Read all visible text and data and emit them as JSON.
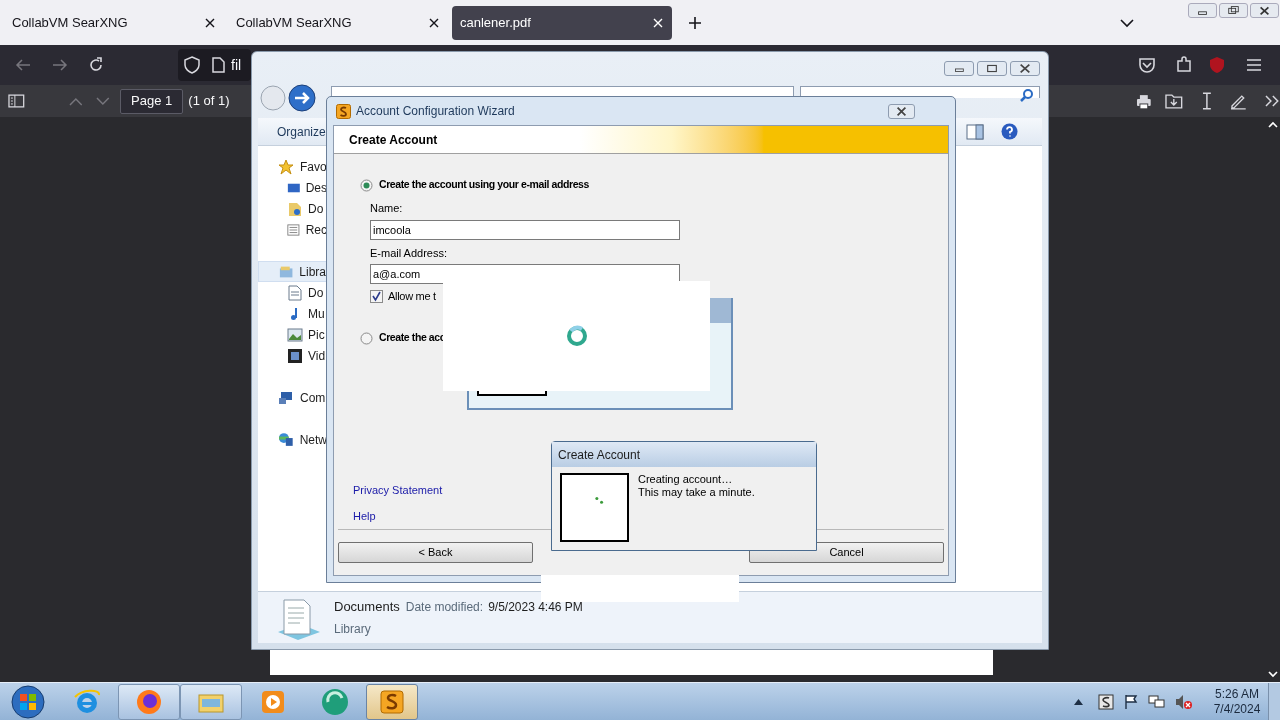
{
  "browser": {
    "tabs": [
      {
        "title": "CollabVM SearXNG",
        "selected": false
      },
      {
        "title": "CollabVM SearXNG",
        "selected": false
      },
      {
        "title": "canlener.pdf",
        "selected": true
      }
    ],
    "address": "fil",
    "page_field": "Page 1",
    "page_count": "(1 of 1)"
  },
  "explorer": {
    "toolbar_label": "Organize",
    "nav": [
      {
        "label": "Favo",
        "selected": false,
        "children": [
          {
            "label": "Des",
            "selected": false
          },
          {
            "label": "Do",
            "selected": false
          },
          {
            "label": "Rec",
            "selected": false
          }
        ]
      },
      {
        "label": "Libra",
        "selected": true,
        "children": [
          {
            "label": "Do",
            "selected": false
          },
          {
            "label": "Mu",
            "selected": false
          },
          {
            "label": "Pic",
            "selected": false
          },
          {
            "label": "Vid",
            "selected": false
          }
        ]
      },
      {
        "label": "Com",
        "selected": false
      },
      {
        "label": "Netw",
        "selected": false
      }
    ],
    "details": {
      "name": "Documents",
      "date_label": "Date modified:",
      "date": "9/5/2023 4:46 PM",
      "type": "Library"
    }
  },
  "wizard": {
    "title": "Account Configuration Wizard",
    "heading": "Create Account",
    "radios": [
      {
        "label": "Create the account using your e-mail address",
        "selected": true
      },
      {
        "label": "Create the acc",
        "selected": false
      }
    ],
    "fields": [
      {
        "label": "Name:",
        "value": "imcoola"
      },
      {
        "label": "E-mail Address:",
        "value": "a@a.com"
      }
    ],
    "checkbox": {
      "label": "Allow me t",
      "checked": true
    },
    "links": [
      "Privacy Statement",
      "Help"
    ],
    "buttons": [
      "< Back",
      "Cancel"
    ]
  },
  "progress_dialog": {
    "title": "Create Account",
    "lines": [
      "Creating account…",
      "This may take a minute."
    ]
  },
  "taskbar": {
    "apps": [
      {
        "open": false,
        "selected": false
      },
      {
        "open": true,
        "selected": false
      },
      {
        "open": true,
        "selected": false
      },
      {
        "open": false,
        "selected": false
      },
      {
        "open": false,
        "selected": false
      },
      {
        "open": true,
        "selected": true
      }
    ],
    "clock_time": "5:26 AM",
    "clock_date": "7/4/2024"
  }
}
